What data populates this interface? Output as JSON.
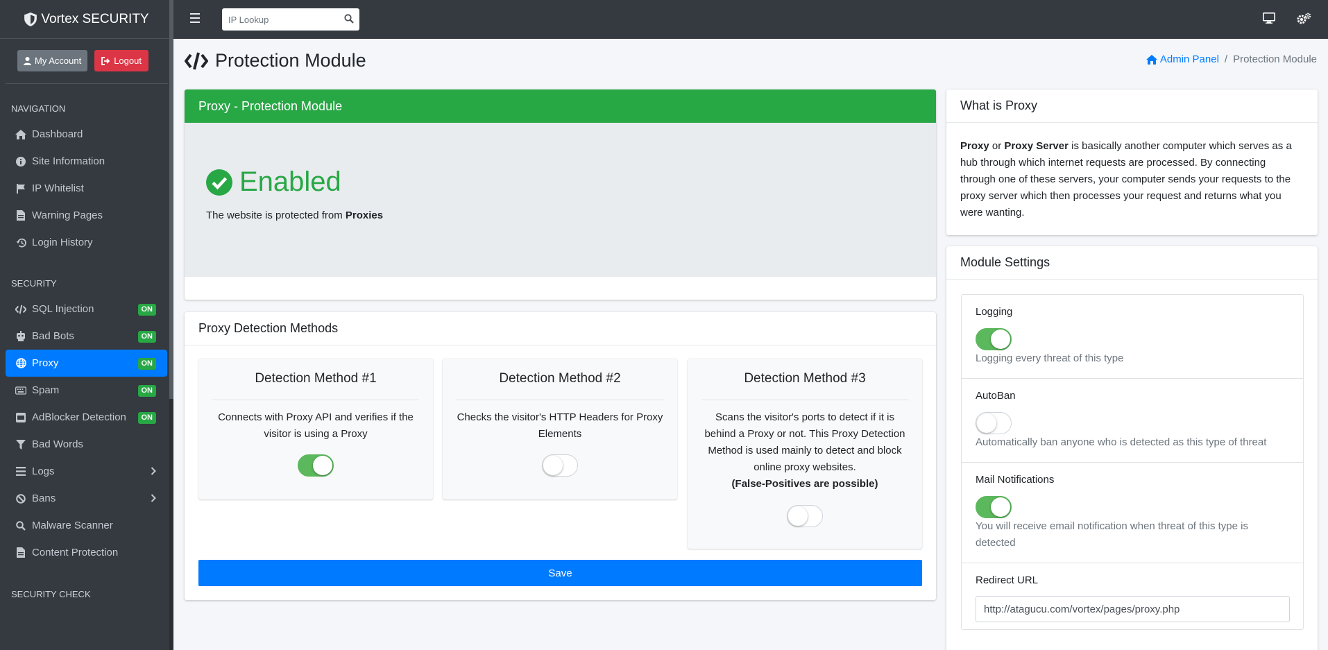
{
  "brand": {
    "name": "Vortex SECURITY"
  },
  "user": {
    "account_label": "My Account",
    "logout_label": "Logout"
  },
  "sidebar": {
    "nav_header": "NAVIGATION",
    "nav_items": [
      {
        "label": "Dashboard",
        "icon": "home-icon"
      },
      {
        "label": "Site Information",
        "icon": "info-icon"
      },
      {
        "label": "IP Whitelist",
        "icon": "flag-icon"
      },
      {
        "label": "Warning Pages",
        "icon": "file-icon"
      },
      {
        "label": "Login History",
        "icon": "history-icon"
      }
    ],
    "security_header": "SECURITY",
    "security_items": [
      {
        "label": "SQL Injection",
        "icon": "code-icon",
        "badge": "ON"
      },
      {
        "label": "Bad Bots",
        "icon": "robot-icon",
        "badge": "ON"
      },
      {
        "label": "Proxy",
        "icon": "globe-icon",
        "badge": "ON"
      },
      {
        "label": "Spam",
        "icon": "keyboard-icon",
        "badge": "ON"
      },
      {
        "label": "AdBlocker Detection",
        "icon": "ban-square-icon",
        "badge": "ON"
      },
      {
        "label": "Bad Words",
        "icon": "filter-icon"
      },
      {
        "label": "Logs",
        "icon": "list-icon"
      },
      {
        "label": "Bans",
        "icon": "ban-icon"
      },
      {
        "label": "Malware Scanner",
        "icon": "search-icon"
      },
      {
        "label": "Content Protection",
        "icon": "file-icon"
      }
    ],
    "check_header": "SECURITY CHECK"
  },
  "topbar": {
    "search_placeholder": "IP Lookup"
  },
  "page": {
    "title": "Protection Module",
    "breadcrumb": {
      "home": "Admin Panel",
      "current": "Protection Module"
    }
  },
  "main_card": {
    "title": "Proxy - Protection Module",
    "status": "Enabled",
    "desc_prefix": "The website is protected from ",
    "desc_bold": "Proxies",
    "status_color": "#28a745"
  },
  "methods_card": {
    "title": "Proxy Detection Methods",
    "methods": [
      {
        "title": "Detection Method #1",
        "desc": "Connects with Proxy API and verifies if the visitor is using a Proxy",
        "warning": "",
        "enabled": true
      },
      {
        "title": "Detection Method #2",
        "desc": "Checks the visitor's HTTP Headers for Proxy Elements",
        "warning": "",
        "enabled": false
      },
      {
        "title": "Detection Method #3",
        "desc": "Scans the visitor's ports to detect if it is behind a Proxy or not. This Proxy Detection Method is used mainly to detect and block online proxy websites.",
        "warning": "(False-Positives are possible)",
        "enabled": false
      }
    ],
    "save_label": "Save"
  },
  "what_card": {
    "title": "What is Proxy",
    "term1": "Proxy",
    "or": " or ",
    "term2": "Proxy Server",
    "body": " is basically another computer which serves as a hub through which internet requests are processed. By connecting through one of these servers, your computer sends your requests to the proxy server which then processes your request and returns what you were wanting."
  },
  "settings_card": {
    "title": "Module Settings",
    "logging": {
      "label": "Logging",
      "help": "Logging every threat of this type",
      "enabled": true
    },
    "autoban": {
      "label": "AutoBan",
      "help": "Automatically ban anyone who is detected as this type of threat",
      "enabled": false
    },
    "mail": {
      "label": "Mail Notifications",
      "help": "You will receive email notification when threat of this type is detected",
      "enabled": true
    },
    "redirect": {
      "label": "Redirect URL",
      "value": "http://atagucu.com/vortex/pages/proxy.php"
    }
  },
  "colors": {
    "accent": "#007bff",
    "success": "#28a745",
    "danger": "#dc3545",
    "sidebar": "#343a40"
  }
}
